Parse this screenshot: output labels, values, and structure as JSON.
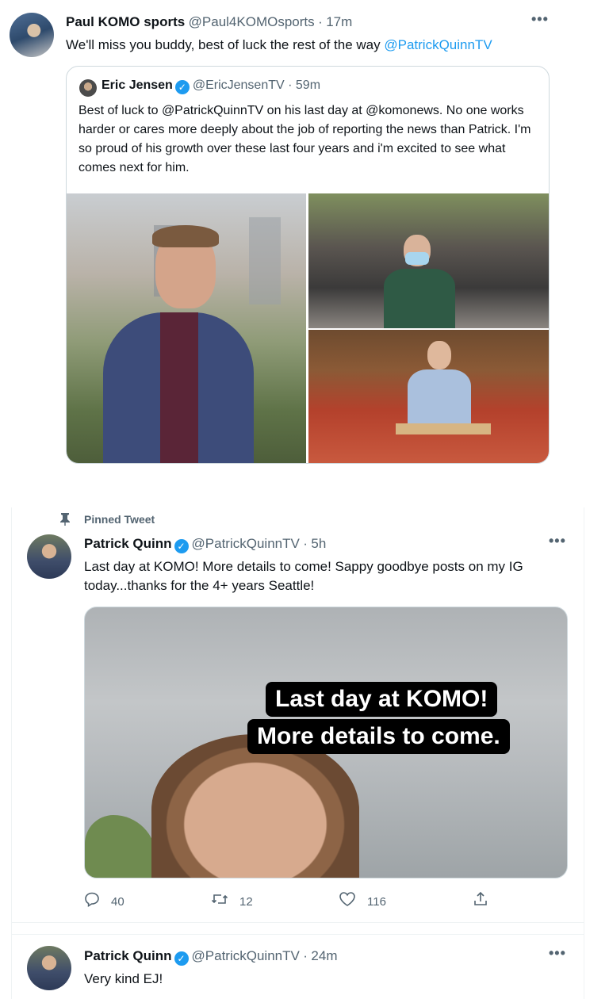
{
  "tweets": [
    {
      "author": "Paul KOMO sports",
      "handle": "@Paul4KOMOsports",
      "time": "17m",
      "text_before": "We'll miss you buddy, best of luck the rest of the way ",
      "text_mention": "@PatrickQuinnTV",
      "quote": {
        "author": "Eric Jensen",
        "handle": "@EricJensenTV",
        "time": "59m",
        "text": "Best of luck to @PatrickQuinnTV on his last day at @komonews. No one works harder or cares more deeply about the job of reporting the news than Patrick. I'm so proud of his growth over these last four years and i'm excited to see what comes next for him."
      }
    },
    {
      "pinned_label": "Pinned Tweet",
      "author": "Patrick Quinn",
      "handle": "@PatrickQuinnTV",
      "time": "5h",
      "text": "Last day at KOMO! More details to come! Sappy goodbye posts on my IG today...thanks for the 4+ years Seattle!",
      "media_caption_1": "Last day at KOMO!",
      "media_caption_2": "More details to come.",
      "reply_count": "40",
      "retweet_count": "12",
      "like_count": "116"
    },
    {
      "author": "Patrick Quinn",
      "handle": "@PatrickQuinnTV",
      "time": "24m",
      "text": "Very kind EJ!"
    }
  ],
  "separator": "·",
  "more_glyph": "•••",
  "icons": {
    "more": "more-icon",
    "verified": "verified-badge-icon",
    "pin": "pin-icon",
    "reply": "reply-icon",
    "retweet": "retweet-icon",
    "like": "heart-icon",
    "share": "share-icon"
  },
  "colors": {
    "link": "#1d9bf0",
    "secondary_text": "#536471",
    "verified": "#1d9bf0",
    "border": "#cfd9de"
  }
}
